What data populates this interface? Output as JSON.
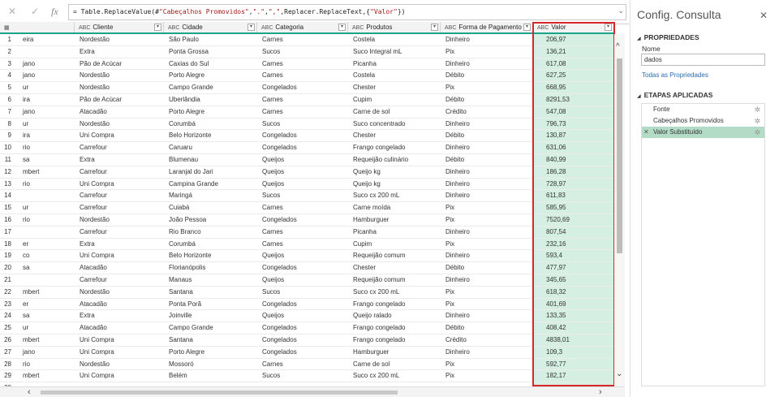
{
  "formula": {
    "prefix": "= Table.ReplaceValue(#",
    "arg1": "\"Cabeçalhos Promovidos\"",
    "mid1": ",",
    "arg2": "\".\"",
    "mid2": ",",
    "arg3": "\",\"",
    "mid3": ",Replacer.ReplaceText,{",
    "arg4": "\"Valor\"",
    "suffix": "})"
  },
  "columns": [
    {
      "label": "",
      "type": "▦"
    },
    {
      "label": "Cliente",
      "type": "ABC"
    },
    {
      "label": "Cidade",
      "type": "ABC"
    },
    {
      "label": "Categoria",
      "type": "ABC"
    },
    {
      "label": "Produtos",
      "type": "ABC"
    },
    {
      "label": "Forma de Pagamento",
      "type": "ABC"
    },
    {
      "label": "Valor",
      "type": "ABC"
    }
  ],
  "rows": [
    [
      "1",
      "eira",
      "Nordestão",
      "São Paulo",
      "Carnes",
      "Costela",
      "Dinheiro",
      "206,97"
    ],
    [
      "2",
      "",
      "Extra",
      "Ponta Grossa",
      "Sucos",
      "Suco Integral mL",
      "Pix",
      "136,21"
    ],
    [
      "3",
      "jano",
      "Pão de Acúcar",
      "Caxias do Sul",
      "Carnes",
      "Picanha",
      "Dinheiro",
      "617,08"
    ],
    [
      "4",
      "jano",
      "Nordestão",
      "Porto Alegre",
      "Carnes",
      "Costela",
      "Débito",
      "627,25"
    ],
    [
      "5",
      "ur",
      "Nordestão",
      "Campo Grande",
      "Congelados",
      "Chester",
      "Pix",
      "668,95"
    ],
    [
      "6",
      "ira",
      "Pão de Acúcar",
      "Uberlândia",
      "Carnes",
      "Cupim",
      "Débito",
      "8291,53"
    ],
    [
      "7",
      "jano",
      "Atacadão",
      "Porto Alegre",
      "Carnes",
      "Carne de sol",
      "Crédito",
      "547,08"
    ],
    [
      "8",
      "ur",
      "Nordestão",
      "Corumbá",
      "Sucos",
      "Suco concentrado",
      "Dinheiro",
      "796,73"
    ],
    [
      "9",
      "ira",
      "Uni Compra",
      "Belo Horizonte",
      "Congelados",
      "Chester",
      "Débito",
      "130,87"
    ],
    [
      "10",
      "rio",
      "Carrefour",
      "Caruaru",
      "Congelados",
      "Frango congelado",
      "Dinheiro",
      "631,06"
    ],
    [
      "11",
      "sa",
      "Extra",
      "Blumenau",
      "Queijos",
      "Requeijão culinário",
      "Débito",
      "840,99"
    ],
    [
      "12",
      "mbert",
      "Carrefour",
      "Laranjal do Jari",
      "Queijos",
      "Queijo kg",
      "Dinheiro",
      "186,28"
    ],
    [
      "13",
      "rio",
      "Uni Compra",
      "Campina Grande",
      "Queijos",
      "Queijo kg",
      "Dinheiro",
      "728,97"
    ],
    [
      "14",
      "",
      "Carrefour",
      "Maringá",
      "Sucos",
      "Suco cx 200 mL",
      "Dinheiro",
      "611,83"
    ],
    [
      "15",
      "ur",
      "Carrefour",
      "Cuiabá",
      "Carnes",
      "Carne moída",
      "Pix",
      "585,95"
    ],
    [
      "16",
      "rio",
      "Nordestão",
      "João Pessoa",
      "Congelados",
      "Hamburguer",
      "Pix",
      "7520,69"
    ],
    [
      "17",
      "",
      "Carrefour",
      "Rio Branco",
      "Carnes",
      "Picanha",
      "Dinheiro",
      "807,54"
    ],
    [
      "18",
      "er",
      "Extra",
      "Corumbá",
      "Carnes",
      "Cupim",
      "Pix",
      "232,16"
    ],
    [
      "19",
      "co",
      "Uni Compra",
      "Belo Horizonte",
      "Queijos",
      "Requeijão comum",
      "Dinheiro",
      "593,4"
    ],
    [
      "20",
      "sa",
      "Atacadão",
      "Florianópolis",
      "Congelados",
      "Chester",
      "Débito",
      "477,97"
    ],
    [
      "21",
      "",
      "Carrefour",
      "Manaus",
      "Queijos",
      "Requeijão comum",
      "Dinheiro",
      "345,65"
    ],
    [
      "22",
      "mbert",
      "Nordestão",
      "Santana",
      "Sucos",
      "Suco cx 200 mL",
      "Pix",
      "618,32"
    ],
    [
      "23",
      "er",
      "Atacadão",
      "Ponta Porã",
      "Congelados",
      "Frango congelado",
      "Pix",
      "401,69"
    ],
    [
      "24",
      "sa",
      "Extra",
      "Joinville",
      "Queijos",
      "Queijo ralado",
      "Dinheiro",
      "133,35"
    ],
    [
      "25",
      "ur",
      "Atacadão",
      "Campo Grande",
      "Congelados",
      "Frango congelado",
      "Débito",
      "408,42"
    ],
    [
      "26",
      "mbert",
      "Uni Compra",
      "Santana",
      "Congelados",
      "Frango congelado",
      "Crédito",
      "4838,01"
    ],
    [
      "27",
      "jano",
      "Uni Compra",
      "Porto Alegre",
      "Congelados",
      "Hamburguer",
      "Dinheiro",
      "109,3"
    ],
    [
      "28",
      "rio",
      "Nordestão",
      "Mossoró",
      "Carnes",
      "Carne de sol",
      "Pix",
      "592,77"
    ],
    [
      "29",
      "mbert",
      "Uni Compra",
      "Belém",
      "Sucos",
      "Suco cx 200 mL",
      "Pix",
      "182,17"
    ],
    [
      "30",
      "",
      "",
      "",
      "",
      "",
      "",
      ""
    ]
  ],
  "pane": {
    "title": "Config. Consulta",
    "properties_header": "PROPRIEDADES",
    "name_label": "Nome",
    "name_value": "dados",
    "all_props_link": "Todas as Propriedades",
    "steps_header": "ETAPAS APLICADAS",
    "steps": [
      "Fonte",
      "Cabeçalhos Promovidos",
      "Valor Substituído"
    ]
  },
  "colors": {
    "accent": "#1aa58a",
    "highlight": "#d9262c",
    "selected_col": "#d6efe3"
  }
}
